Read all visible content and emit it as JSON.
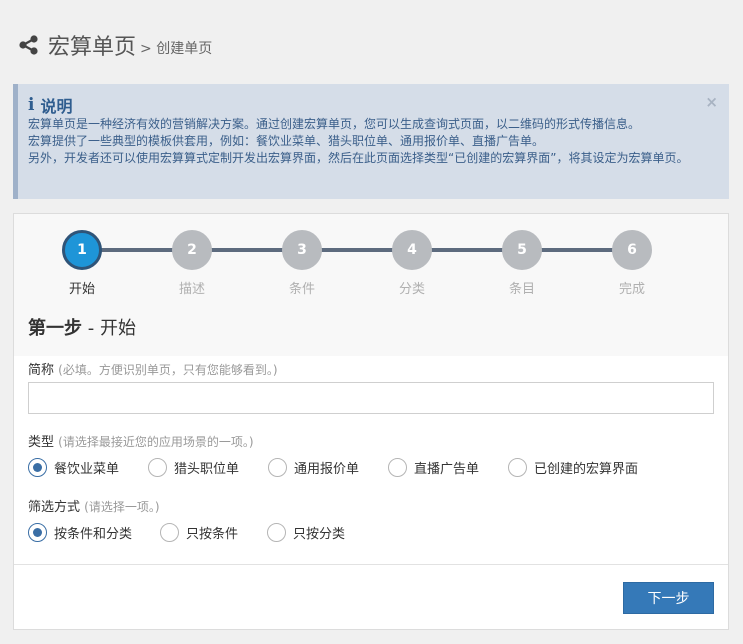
{
  "header": {
    "title": "宏算单页",
    "breadcrumb": "> 创建单页"
  },
  "info": {
    "icon": "info-icon",
    "title": "说明",
    "lines": [
      "宏算单页是一种经济有效的营销解决方案。通过创建宏算单页，您可以生成查询式页面，以二维码的形式传播信息。",
      "宏算提供了一些典型的模板供套用，例如：餐饮业菜单、猎头职位单、通用报价单、直播广告单。",
      "另外，开发者还可以使用宏算算式定制开发出宏算界面，然后在此页面选择类型“已创建的宏算界面”，将其设定为宏算单页。"
    ],
    "close": "×"
  },
  "steps": [
    {
      "num": "1",
      "label": "开始",
      "active": true
    },
    {
      "num": "2",
      "label": "描述",
      "active": false
    },
    {
      "num": "3",
      "label": "条件",
      "active": false
    },
    {
      "num": "4",
      "label": "分类",
      "active": false
    },
    {
      "num": "5",
      "label": "条目",
      "active": false
    },
    {
      "num": "6",
      "label": "完成",
      "active": false
    }
  ],
  "step_heading": {
    "strong": "第一步",
    "rest": " - 开始"
  },
  "name_field": {
    "label": "简称",
    "hint": "(必填。方便识别单页，只有您能够看到。)",
    "value": "",
    "placeholder": ""
  },
  "type_field": {
    "label": "类型",
    "hint": "(请选择最接近您的应用场景的一项。)",
    "options": [
      "餐饮业菜单",
      "猎头职位单",
      "通用报价单",
      "直播广告单",
      "已创建的宏算界面"
    ],
    "selected": "餐饮业菜单"
  },
  "filter_field": {
    "label": "筛选方式",
    "hint": "(请选择一项。)",
    "options": [
      "按条件和分类",
      "只按条件",
      "只按分类"
    ],
    "selected": "按条件和分类"
  },
  "next_button": "下一步",
  "colors": {
    "accent": "#1e95d8",
    "primary_button": "#3579b8",
    "info_bg": "#d5dde8",
    "info_text": "#3b5f8a"
  }
}
